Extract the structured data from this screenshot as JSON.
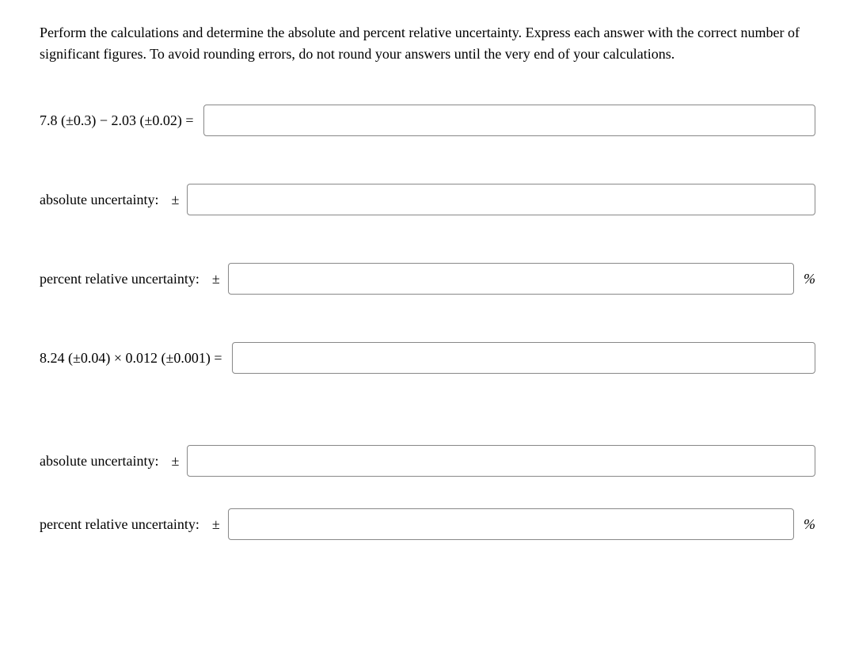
{
  "instructions": "Perform the calculations and determine the absolute and percent relative uncertainty. Express each answer with the correct number of significant figures. To avoid rounding errors, do not round your answers until the very end of your calculations.",
  "symbols": {
    "plus_minus": "±",
    "percent": "%"
  },
  "q1": {
    "expression": "7.8 (±0.3) − 2.03 (±0.02) =",
    "absolute_label": "absolute uncertainty:",
    "relative_label": "percent relative uncertainty:",
    "result_value": "",
    "absolute_value": "",
    "relative_value": ""
  },
  "q2": {
    "expression": "8.24 (±0.04) × 0.012 (±0.001) =",
    "absolute_label": "absolute uncertainty:",
    "relative_label": "percent relative uncertainty:",
    "result_value": "",
    "absolute_value": "",
    "relative_value": ""
  }
}
